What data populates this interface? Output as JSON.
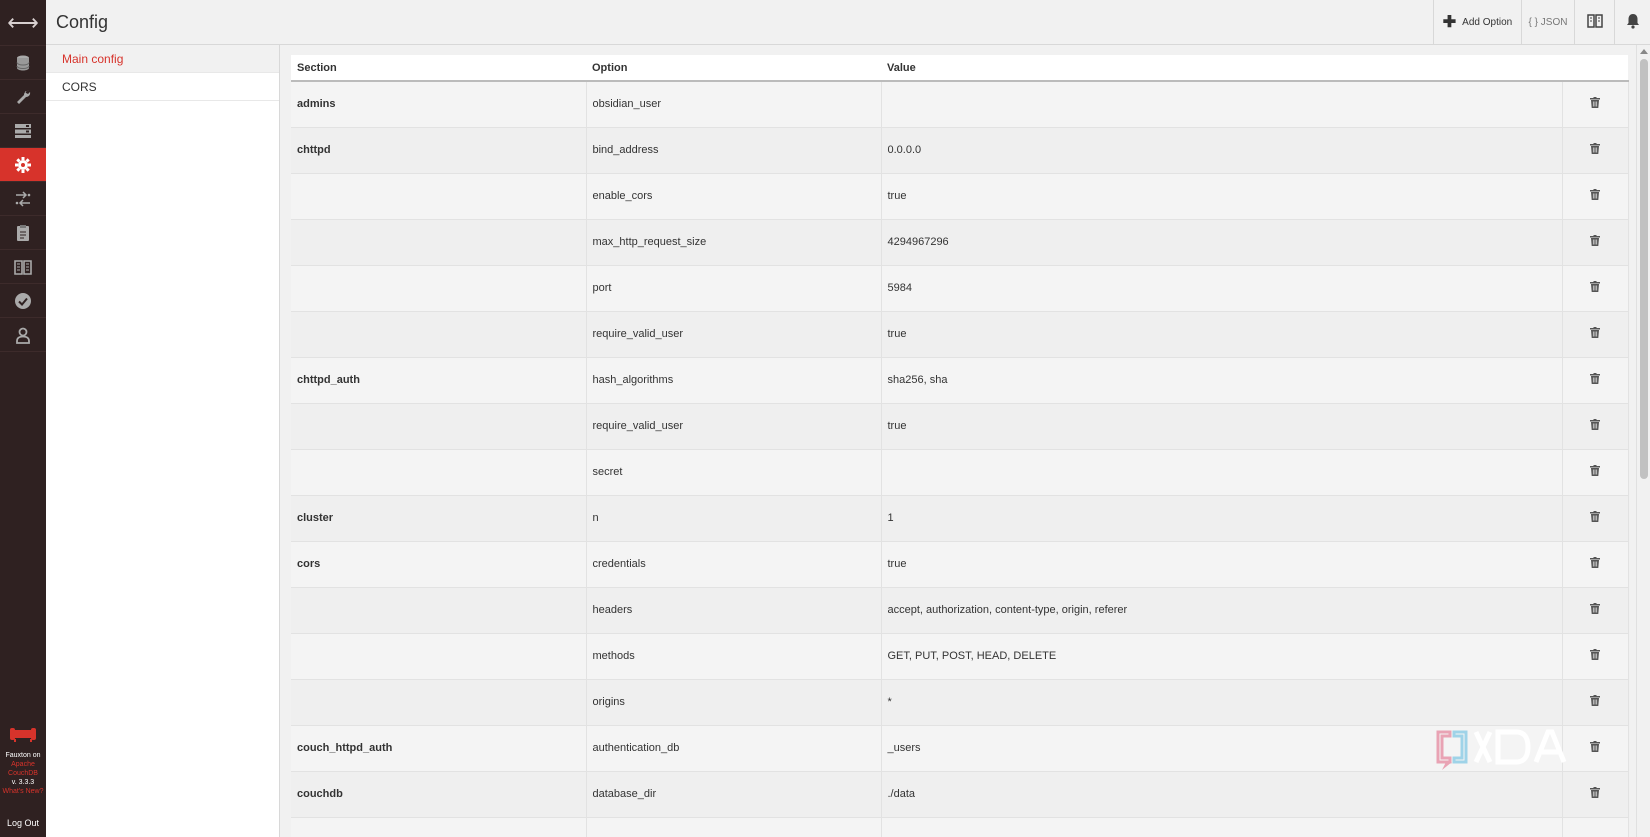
{
  "header": {
    "title": "Config",
    "add_option_label": "Add Option",
    "json_label": "{ } JSON"
  },
  "nav": {
    "items": [
      "databases-icon",
      "setup-icon",
      "active-tasks-icon",
      "config-icon",
      "replication-icon",
      "documentation-icon",
      "docs-icon",
      "verify-icon",
      "user-icon"
    ],
    "active": "config-icon",
    "footer": {
      "line1": "Fauxton on",
      "line2": "Apache",
      "line3": "CouchDB",
      "version": "v. 3.3.3",
      "whats_new": "What's New?",
      "logout": "Log Out"
    }
  },
  "sidebar": {
    "items": [
      {
        "label": "Main config",
        "active": true
      },
      {
        "label": "CORS",
        "active": false
      }
    ]
  },
  "table": {
    "headers": [
      "Section",
      "Option",
      "Value"
    ],
    "rows": [
      {
        "section": "admins",
        "option": "obsidian_user",
        "value": ""
      },
      {
        "section": "chttpd",
        "option": "bind_address",
        "value": "0.0.0.0"
      },
      {
        "section": "",
        "option": "enable_cors",
        "value": "true"
      },
      {
        "section": "",
        "option": "max_http_request_size",
        "value": "4294967296"
      },
      {
        "section": "",
        "option": "port",
        "value": "5984"
      },
      {
        "section": "",
        "option": "require_valid_user",
        "value": "true"
      },
      {
        "section": "chttpd_auth",
        "option": "hash_algorithms",
        "value": "sha256, sha"
      },
      {
        "section": "",
        "option": "require_valid_user",
        "value": "true"
      },
      {
        "section": "",
        "option": "secret",
        "value": ""
      },
      {
        "section": "cluster",
        "option": "n",
        "value": "1"
      },
      {
        "section": "cors",
        "option": "credentials",
        "value": "true"
      },
      {
        "section": "",
        "option": "headers",
        "value": "accept, authorization, content-type, origin, referer"
      },
      {
        "section": "",
        "option": "methods",
        "value": "GET, PUT, POST, HEAD, DELETE"
      },
      {
        "section": "",
        "option": "origins",
        "value": "*"
      },
      {
        "section": "couch_httpd_auth",
        "option": "authentication_db",
        "value": "_users"
      },
      {
        "section": "couchdb",
        "option": "database_dir",
        "value": "./data"
      },
      {
        "section": "",
        "option": "",
        "value": ""
      }
    ]
  },
  "watermark": {
    "text": "XDA"
  },
  "colors": {
    "accent": "#d7332b",
    "nav_bg": "#2f2121"
  }
}
